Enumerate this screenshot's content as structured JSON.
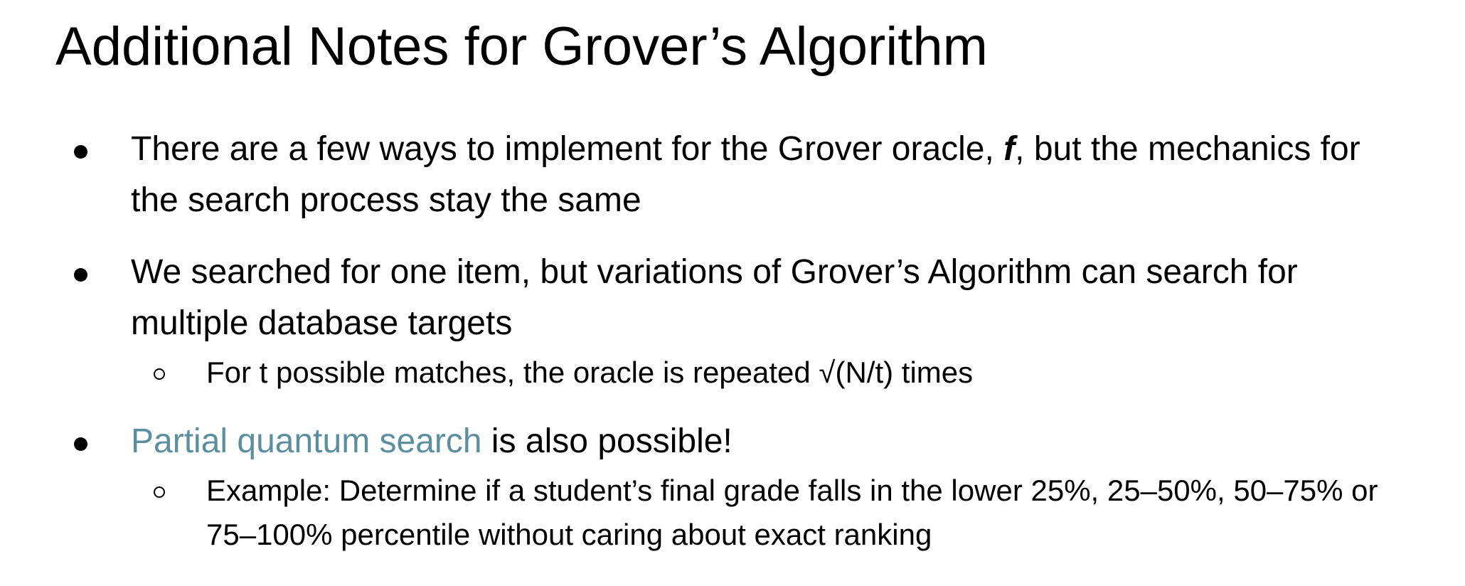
{
  "slide": {
    "title": "Additional Notes for Grover’s Algorithm",
    "bullets": [
      {
        "part1": "There are a few ways to implement for the Grover oracle, ",
        "emphasis": "f",
        "part2": ", but the mechanics for the search process stay the same"
      },
      {
        "text": "We searched for one item, but variations of Grover’s Algorithm can search for multiple database targets",
        "subitems": [
          {
            "text": "For t possible matches, the oracle is repeated √(N/t) times"
          }
        ]
      },
      {
        "link_text": "Partial quantum search",
        "rest": " is also possible!",
        "link_color": "#5b8f9f",
        "subitems": [
          {
            "text": "Example: Determine if a student’s final grade falls in the lower 25%, 25–50%, 50–75% or 75–100% percentile without caring about exact ranking"
          }
        ]
      }
    ]
  }
}
